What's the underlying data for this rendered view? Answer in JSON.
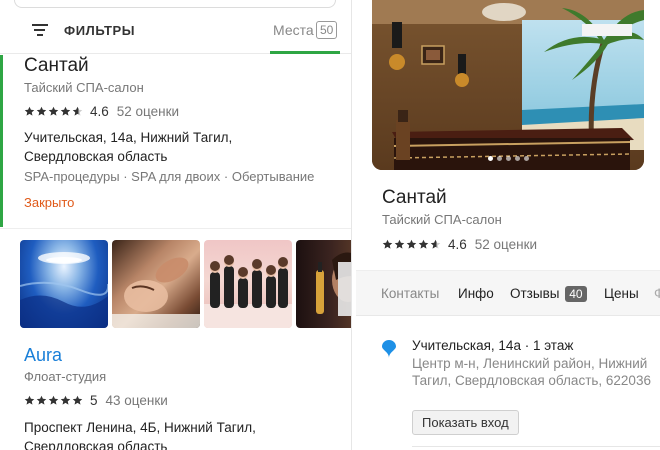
{
  "filters": {
    "label": "ФИЛЬТРЫ"
  },
  "places_tab": {
    "label": "Места",
    "count": "50"
  },
  "results": [
    {
      "name": "Сантай",
      "category": "Тайский СПА-салон",
      "rating": "4.6",
      "rating_fraction": 0.92,
      "reviews": "52 оценки",
      "address_line1": "Учительская, 14а, Нижний Тагил,",
      "address_line2": "Свердловская область",
      "services": "SPA-процедуры · SPA для двоих · Обертывание",
      "status": "Закрыто"
    },
    {
      "name": "Aura",
      "category": "Флоат-студия",
      "rating": "5",
      "rating_fraction": 1.0,
      "reviews": "43 оценки",
      "address_line1": "Проспект Ленина, 4Б, Нижний Тагил,",
      "address_line2": "Свердловская область"
    }
  ],
  "detail": {
    "name": "Сантай",
    "category": "Тайский СПА-салон",
    "rating": "4.6",
    "reviews": "52 оценки",
    "tabs": [
      {
        "label": "Контакты",
        "active": true
      },
      {
        "label": "Инфо"
      },
      {
        "label": "Отзывы",
        "count": "40"
      },
      {
        "label": "Цены"
      },
      {
        "label": "Ф"
      }
    ],
    "address_main": "Учительская, 14а · 1 этаж",
    "address_secondary": "Центр м-н, Ленинский район, Нижний Тагил, Свердловская область, 622036",
    "entrance_button": "Показать вход"
  },
  "colors": {
    "accent_green": "#2fa644",
    "link_blue": "#1a7fd8",
    "closed_orange": "#e05a1a",
    "star": "#333333"
  },
  "icons": [
    "filter-icon",
    "star-icon",
    "map-pin-icon",
    "close-icon"
  ]
}
